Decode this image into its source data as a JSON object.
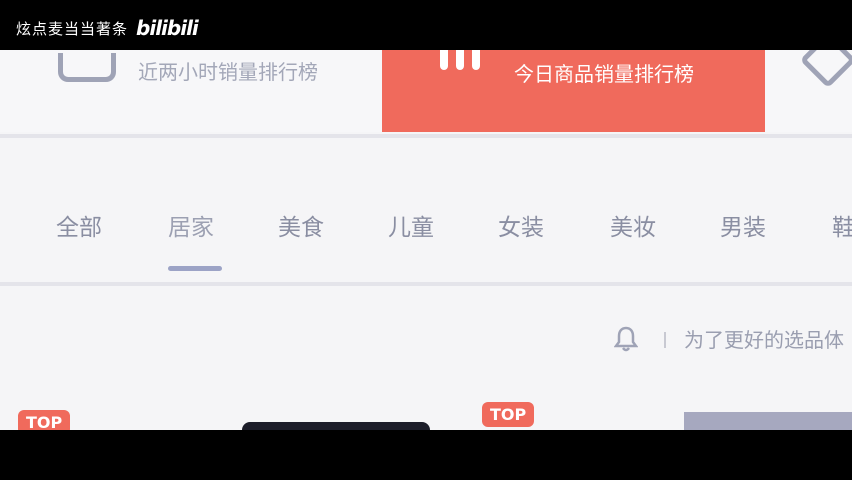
{
  "watermark": {
    "text": "炫点麦当当著条",
    "logo": "bilibili"
  },
  "rank_bar": {
    "left_label": "近两小时销量排行榜",
    "center_label": "今日商品销量排行榜"
  },
  "tabs": [
    {
      "label": "全部"
    },
    {
      "label": "居家",
      "active": true
    },
    {
      "label": "美食"
    },
    {
      "label": "儿童"
    },
    {
      "label": "女装"
    },
    {
      "label": "美妆"
    },
    {
      "label": "男装"
    },
    {
      "label": "鞋"
    }
  ],
  "notice": {
    "text": "为了更好的选品体"
  },
  "badges": {
    "left": "TOP",
    "center": "TOP"
  },
  "colors": {
    "accent": "#f06a5c",
    "underline": "#9ca3c6",
    "text_muted": "#8a8ea2"
  }
}
